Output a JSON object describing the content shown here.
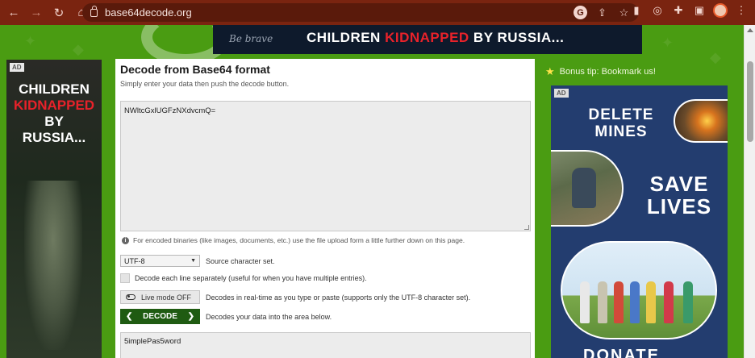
{
  "browser": {
    "url": "base64decode.org",
    "nav": {
      "back": "←",
      "forward": "→",
      "reload": "↻",
      "home": "⌂"
    }
  },
  "ads": {
    "badge": "AD",
    "top_banner": {
      "left_text": "Be brave",
      "text_pre": "CHILDREN ",
      "text_red": "KIDNAPPED",
      "text_post": " BY RUSSIA..."
    },
    "left": {
      "line1": "CHILDREN",
      "line2": "KIDNAPPED",
      "line3": "BY",
      "line4": "RUSSIA..."
    },
    "right": {
      "title1": "DELETE MINES",
      "title2": "SAVE LIVES",
      "bottom": "DONATE"
    }
  },
  "main": {
    "title": "Decode from Base64 format",
    "subtitle": "Simply enter your data then push the decode button.",
    "input_value": "NWltcGxlUGFzNXdvcmQ=",
    "info_text": "For encoded binaries (like images, documents, etc.) use the file upload form a little further down on this page.",
    "charset": {
      "selected": "UTF-8",
      "label": "Source character set."
    },
    "separate": {
      "label": "Decode each line separately (useful for when you have multiple entries)."
    },
    "live_mode": {
      "button": "Live mode OFF",
      "label": "Decodes in real-time as you type or paste (supports only the UTF-8 character set)."
    },
    "decode": {
      "button": "DECODE",
      "label": "Decodes your data into the area below."
    },
    "output_value": "5implePas5word"
  },
  "sidebar": {
    "bonus_tip": "Bonus tip: Bookmark us!"
  },
  "colors": {
    "chrome": "#7a2410",
    "page_green": "#4a9c12",
    "decode_button": "#1f5b12",
    "accent_red": "#e8222a"
  }
}
